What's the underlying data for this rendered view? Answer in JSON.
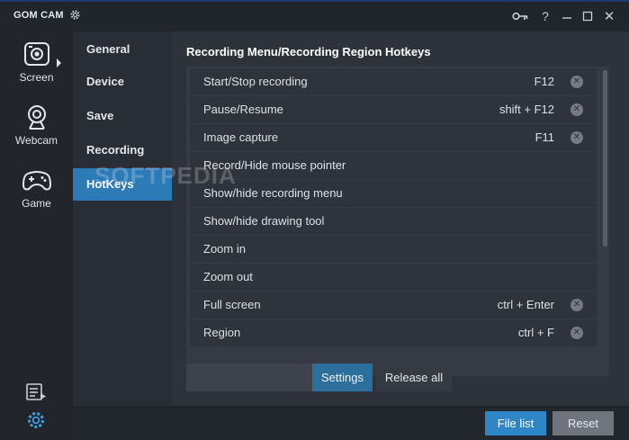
{
  "app": {
    "title": "GOM CAM"
  },
  "titlebar": {
    "icons": [
      "gear-icon",
      "key-icon",
      "help-icon",
      "minimize-icon",
      "maximize-icon",
      "close-icon"
    ],
    "help_label": "?",
    "close_label": "✕"
  },
  "leftnav": {
    "items": [
      {
        "label": "Screen",
        "icon": "screen-capture-icon"
      },
      {
        "label": "Webcam",
        "icon": "webcam-icon"
      },
      {
        "label": "Game",
        "icon": "gamepad-icon"
      }
    ],
    "bottom_icons": [
      "file-list-icon",
      "settings-gear-icon"
    ]
  },
  "subnav": {
    "items": [
      "General",
      "Device",
      "Save",
      "Recording",
      "HotKeys"
    ],
    "active": "HotKeys"
  },
  "main": {
    "section_title": "Recording Menu/Recording Region Hotkeys",
    "hotkeys": [
      {
        "label": "Start/Stop recording",
        "key": "F12",
        "clear": "✕"
      },
      {
        "label": "Pause/Resume",
        "key": "shift + F12",
        "clear": "✕"
      },
      {
        "label": "Image capture",
        "key": "F11",
        "clear": "✕"
      },
      {
        "label": "Record/Hide mouse pointer",
        "key": "",
        "clear": ""
      },
      {
        "label": "Show/hide recording menu",
        "key": "",
        "clear": ""
      },
      {
        "label": "Show/hide drawing tool",
        "key": "",
        "clear": ""
      },
      {
        "label": "Zoom in",
        "key": "",
        "clear": ""
      },
      {
        "label": "Zoom out",
        "key": "",
        "clear": ""
      },
      {
        "label": "Full screen",
        "key": "ctrl + Enter",
        "clear": "✕"
      },
      {
        "label": "Region",
        "key": "ctrl + F",
        "clear": "✕"
      }
    ],
    "hotkey_input_value": "",
    "settings_label": "Settings",
    "release_all_label": "Release all"
  },
  "footer": {
    "file_list_label": "File list",
    "reset_label": "Reset"
  },
  "watermark": "SOFTPEDIA",
  "colors": {
    "accent": "#2c7ab6",
    "button_blue": "#2f86c6",
    "background": "#2b2f38"
  }
}
